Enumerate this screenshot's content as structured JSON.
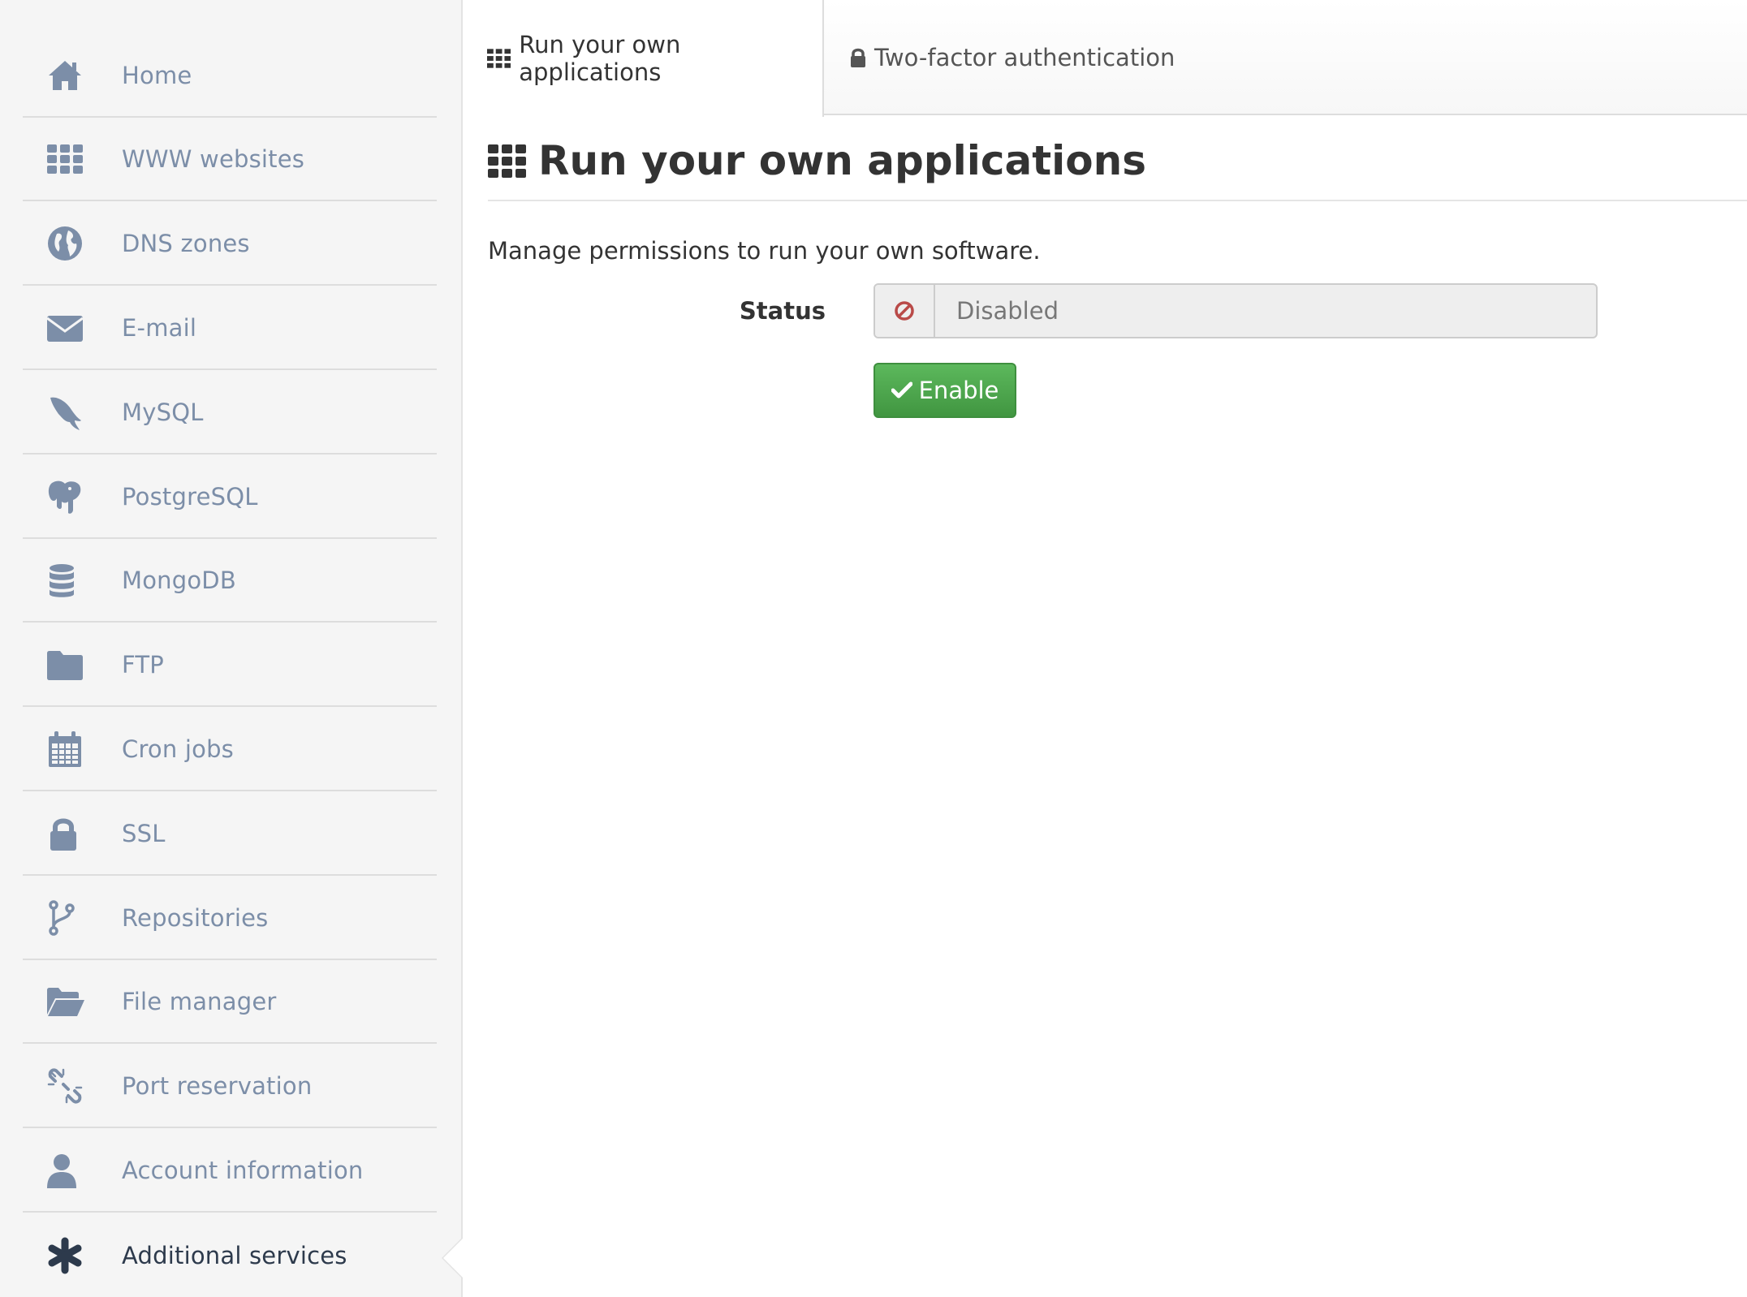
{
  "sidebar": {
    "items": [
      {
        "label": "Home",
        "icon": "home-icon"
      },
      {
        "label": "WWW websites",
        "icon": "grid-icon"
      },
      {
        "label": "DNS zones",
        "icon": "globe-icon"
      },
      {
        "label": "E-mail",
        "icon": "envelope-icon"
      },
      {
        "label": "MySQL",
        "icon": "dolphin-icon"
      },
      {
        "label": "PostgreSQL",
        "icon": "elephant-icon"
      },
      {
        "label": "MongoDB",
        "icon": "database-icon"
      },
      {
        "label": "FTP",
        "icon": "folder-icon"
      },
      {
        "label": "Cron jobs",
        "icon": "calendar-icon"
      },
      {
        "label": "SSL",
        "icon": "lock-icon"
      },
      {
        "label": "Repositories",
        "icon": "git-branch-icon"
      },
      {
        "label": "File manager",
        "icon": "folder-open-icon"
      },
      {
        "label": "Port reservation",
        "icon": "broken-link-icon"
      },
      {
        "label": "Account information",
        "icon": "user-icon"
      },
      {
        "label": "Additional services",
        "icon": "asterisk-icon",
        "active": true
      }
    ]
  },
  "tabs": {
    "run_apps": "Run your own applications",
    "two_factor": "Two-factor authentication"
  },
  "main": {
    "title": "Run your own applications",
    "description": "Manage permissions to run your own software.",
    "status_label": "Status",
    "status_value": "Disabled",
    "enable_button": "Enable"
  },
  "colors": {
    "sidebar_text": "#7c8ea8",
    "sidebar_icon": "#7c8ea8",
    "active_text": "#2d3a4c",
    "success": "#4cae4c",
    "danger": "#b94a48"
  }
}
